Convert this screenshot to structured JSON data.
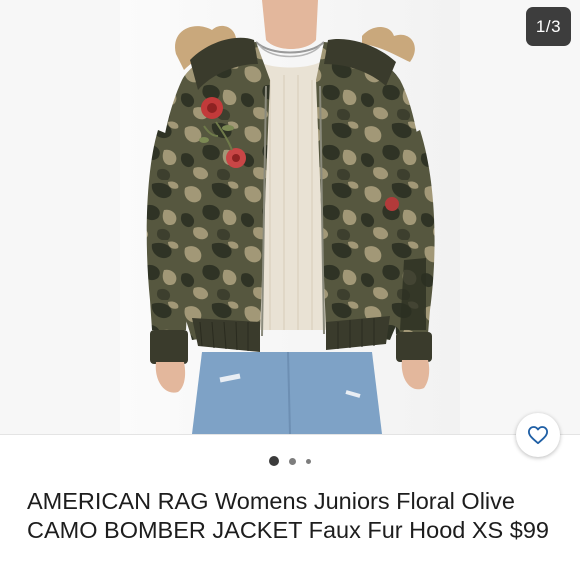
{
  "gallery": {
    "counter": "1/3",
    "page_count": 3,
    "current_page": 1,
    "image_description": "Woman wearing olive camo bomber jacket with floral embroidery, faux fur hood, cream knit sweater and light-wash ripped jeans",
    "colors": {
      "camo_dark": "#2f3325",
      "camo_olive": "#56573f",
      "camo_tan": "#a29877",
      "ribbing": "#3a3b2c",
      "fur": "#c9a87c",
      "sweater": "#e9e2d4",
      "denim": "#7ea2c6"
    }
  },
  "like_button": {
    "icon": "heart-outline-icon",
    "color": "#1f5fa5"
  },
  "pagination": {
    "dots": 3,
    "active": 0
  },
  "listing": {
    "title": "AMERICAN RAG Womens Juniors Floral Olive CAMO BOMBER JACKET Faux Fur Hood XS $99"
  }
}
